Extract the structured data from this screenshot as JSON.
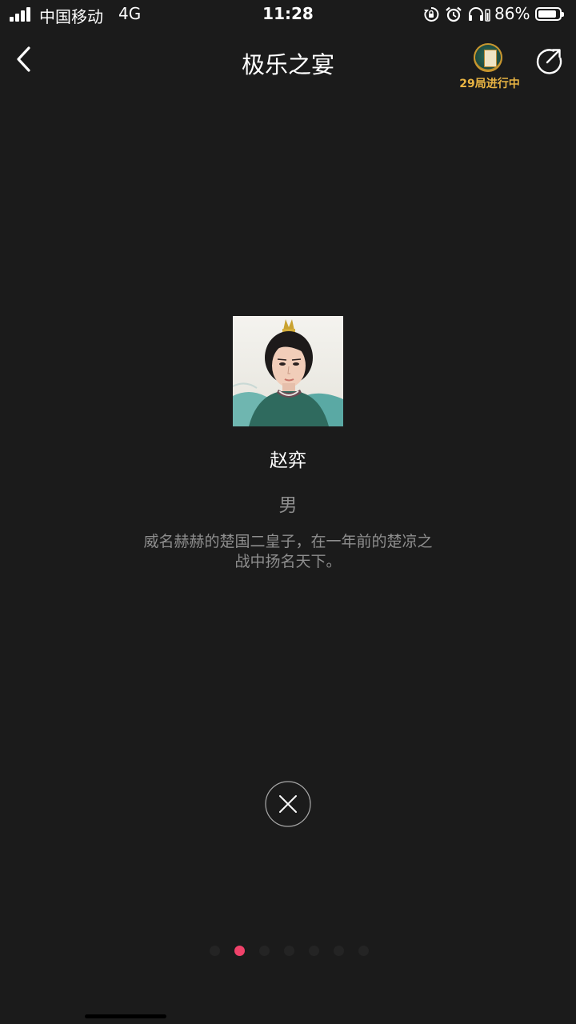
{
  "status_bar": {
    "carrier": "中国移动",
    "network": "4G",
    "time": "11:28",
    "battery_percent": "86%",
    "battery_level": 0.86,
    "icons": [
      "signal-icon",
      "orientation-lock-icon",
      "alarm-icon",
      "headphones-icon",
      "battery-icon"
    ]
  },
  "nav": {
    "title": "极乐之宴",
    "badge_text": "29局进行中",
    "back_icon": "chevron-left-icon",
    "share_icon": "share-icon"
  },
  "character": {
    "name": "赵弈",
    "gender": "男",
    "description": "威名赫赫的楚国二皇子，在一年前的楚凉之战中扬名天下。"
  },
  "pager": {
    "total": 7,
    "active_index": 1,
    "active_color": "#f0426a"
  },
  "close_icon": "close-icon"
}
